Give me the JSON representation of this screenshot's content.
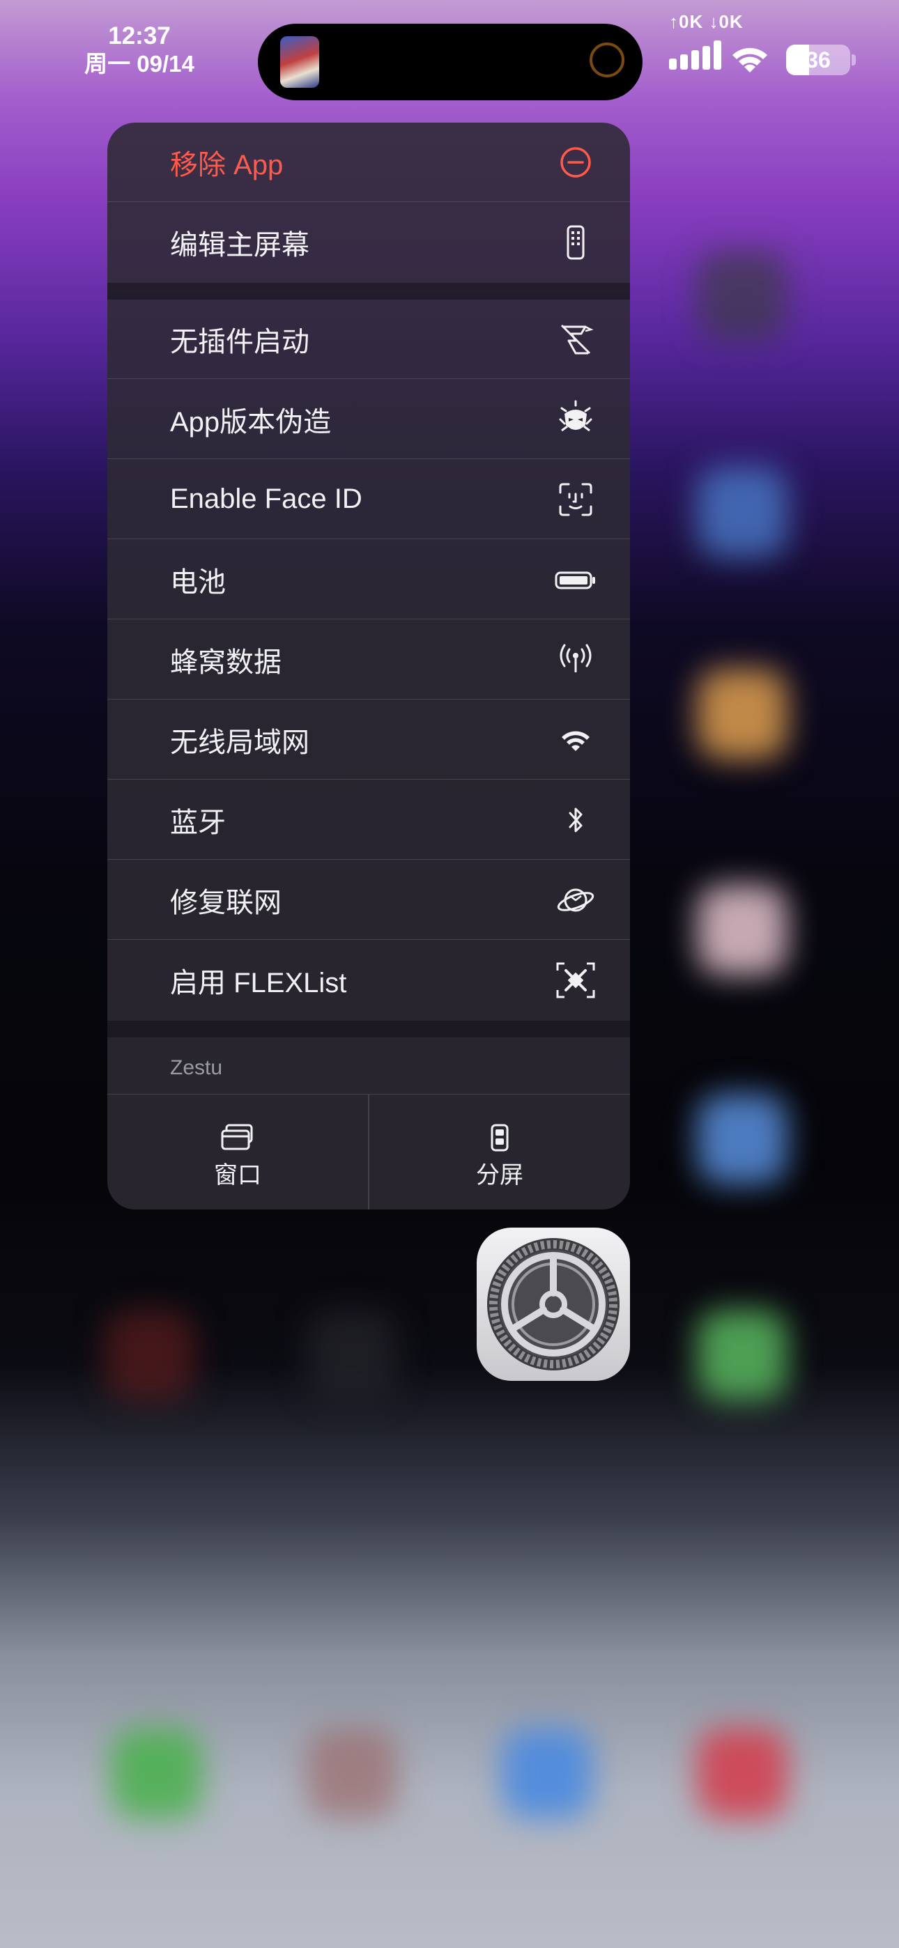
{
  "status_bar": {
    "time": "12:37",
    "date": "周一 09/14",
    "network_speed": "↑0K ↓0K",
    "battery_level": "36"
  },
  "context_menu": {
    "remove_app": {
      "label": "移除 App",
      "icon": "minus-circle-icon",
      "color": "#ff5a4a"
    },
    "edit_home_screen": {
      "label": "编辑主屏幕",
      "icon": "phone-icon"
    },
    "items": [
      {
        "label": "无插件启动",
        "icon": "plug-off-icon"
      },
      {
        "label": "App版本伪造",
        "icon": "mask-icon"
      },
      {
        "label": "Enable Face ID",
        "icon": "face-id-icon"
      },
      {
        "label": "电池",
        "icon": "battery-icon"
      },
      {
        "label": "蜂窝数据",
        "icon": "antenna-icon"
      },
      {
        "label": "无线局域网",
        "icon": "wifi-icon"
      },
      {
        "label": "蓝牙",
        "icon": "bluetooth-icon"
      },
      {
        "label": "修复联网",
        "icon": "network-repair-icon"
      },
      {
        "label": "启用 FLEXList",
        "icon": "flex-target-icon"
      }
    ],
    "section_label": "Zestu",
    "footer": [
      {
        "label": "窗口",
        "icon": "window-icon"
      },
      {
        "label": "分屏",
        "icon": "split-screen-icon"
      }
    ]
  },
  "app_icon": {
    "name": "settings-gear-icon"
  }
}
